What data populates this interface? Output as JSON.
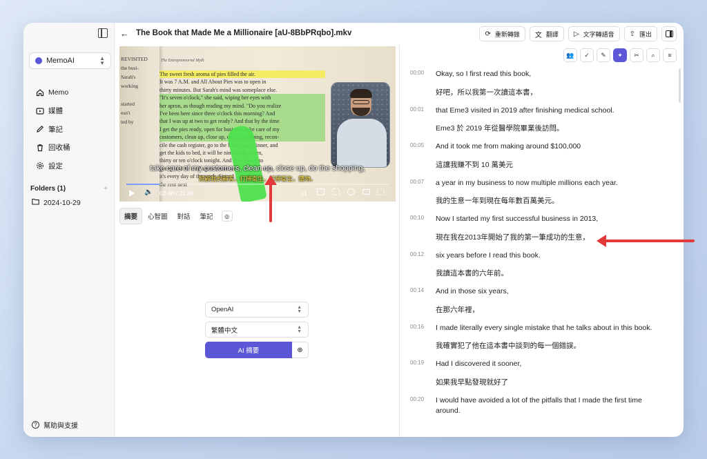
{
  "sidebar": {
    "app_name": "MemoAI",
    "nav": [
      {
        "label": "Memo",
        "icon": "home-icon"
      },
      {
        "label": "媒體",
        "icon": "media-icon"
      },
      {
        "label": "筆記",
        "icon": "pencil-icon"
      },
      {
        "label": "回收桶",
        "icon": "trash-icon"
      },
      {
        "label": "設定",
        "icon": "gear-icon"
      }
    ],
    "folders_label": "Folders (1)",
    "folders": [
      {
        "label": "2024-10-29"
      }
    ],
    "help_label": "幫助與支援"
  },
  "header": {
    "title": "The Book that Made Me a Millionaire [aU-8BbPRqbo].mkv",
    "actions": [
      {
        "label": "重新轉錄",
        "icon": "refresh-icon"
      },
      {
        "label": "翻譯",
        "icon": "translate-icon"
      },
      {
        "label": "文字轉語音",
        "icon": "play-icon"
      },
      {
        "label": "匯出",
        "icon": "upload-icon"
      }
    ]
  },
  "video": {
    "subtitle_en": "take care of my customers, clean up, close up, do the shopping,",
    "subtitle_zh": "照顧我的顧客，打掃衛生，打掃衛生，購物。",
    "time": "02:46 / 21:49",
    "speed": "x1",
    "progress": 0.127,
    "book_header": "The Entrepreneurial Myth",
    "book_left_words": [
      "REVISITED",
      "the busi-",
      "Sarah's",
      "working",
      "",
      "started",
      "esn't",
      "ted by"
    ],
    "book_lines": [
      "The sweet fresh aroma of pies filled the air.",
      "It was 7 A.M. and All About Pies was to open in",
      "thirty minutes. But Sarah's mind was someplace else.",
      "\"It's seven o'clock,\" she said, wiping her eyes with",
      "her apron, as though reading my mind. \"Do you realize",
      "I've been here since three o'clock this morning? And",
      "that I was up at two to get ready? And that by the time",
      "I get the pies ready, open for business, take care of my",
      "customers, clean up, close up, do the shopping, recon-",
      "cile the cash register, go to the bank, have dinner, and",
      "get the kids to bed, it will be nine-thirty or ten,",
      "thirty or ten o'clock tonight. And then I have to",
      "get up and do it all again tomorrow. For God's sake,",
      "it's every day of the week. Since I started",
      "the rent next"
    ]
  },
  "tabs": [
    "摘要",
    "心智圖",
    "對話",
    "筆記"
  ],
  "ai_form": {
    "provider": "OpenAI",
    "language": "繁體中文",
    "summarize_label": "AI 摘要"
  },
  "transcript_tools": [
    "users-icon",
    "check-circle-icon",
    "pencil-icon",
    "sparkle-icon",
    "scissors-icon",
    "search-icon",
    "list-icon"
  ],
  "transcript": [
    {
      "time": "00:00",
      "en": "Okay, so I first read this book,",
      "zh": "好吧，所以我第一次讀這本書，"
    },
    {
      "time": "00:01",
      "en": "that Eme3 visited in 2019 after finishing medical school.",
      "zh": "Eme3 於 2019 年從醫學院畢業後訪問。"
    },
    {
      "time": "00:05",
      "en": "And it took me from making around $100,000",
      "zh": "這讓我賺不到 10 萬美元"
    },
    {
      "time": "00:07",
      "en": "a year in my business to now multiple millions each year.",
      "zh": "我的生意一年到現在每年數百萬美元。"
    },
    {
      "time": "00:10",
      "en": "Now I started my first successful business in 2013,",
      "zh": "現在我在2013年開始了我的第一筆成功的生意，"
    },
    {
      "time": "00:12",
      "en": "six years before I read this book.",
      "zh": "我讀這本書的六年前。"
    },
    {
      "time": "00:14",
      "en": "And in those six years,",
      "zh": "在那六年裡，"
    },
    {
      "time": "00:16",
      "en": "I made literally every single mistake that he talks about in this book.",
      "zh": "我確實犯了他在這本書中談到的每一個錯誤。"
    },
    {
      "time": "00:19",
      "en": "Had I discovered it sooner,",
      "zh": "如果我早點發現就好了"
    },
    {
      "time": "00:20",
      "en": "I would have avoided a lot of the pitfalls that I made the first time around.",
      "zh": ""
    }
  ],
  "colors": {
    "accent": "#5b57d6",
    "annotation_arrow": "#e23a3a"
  }
}
